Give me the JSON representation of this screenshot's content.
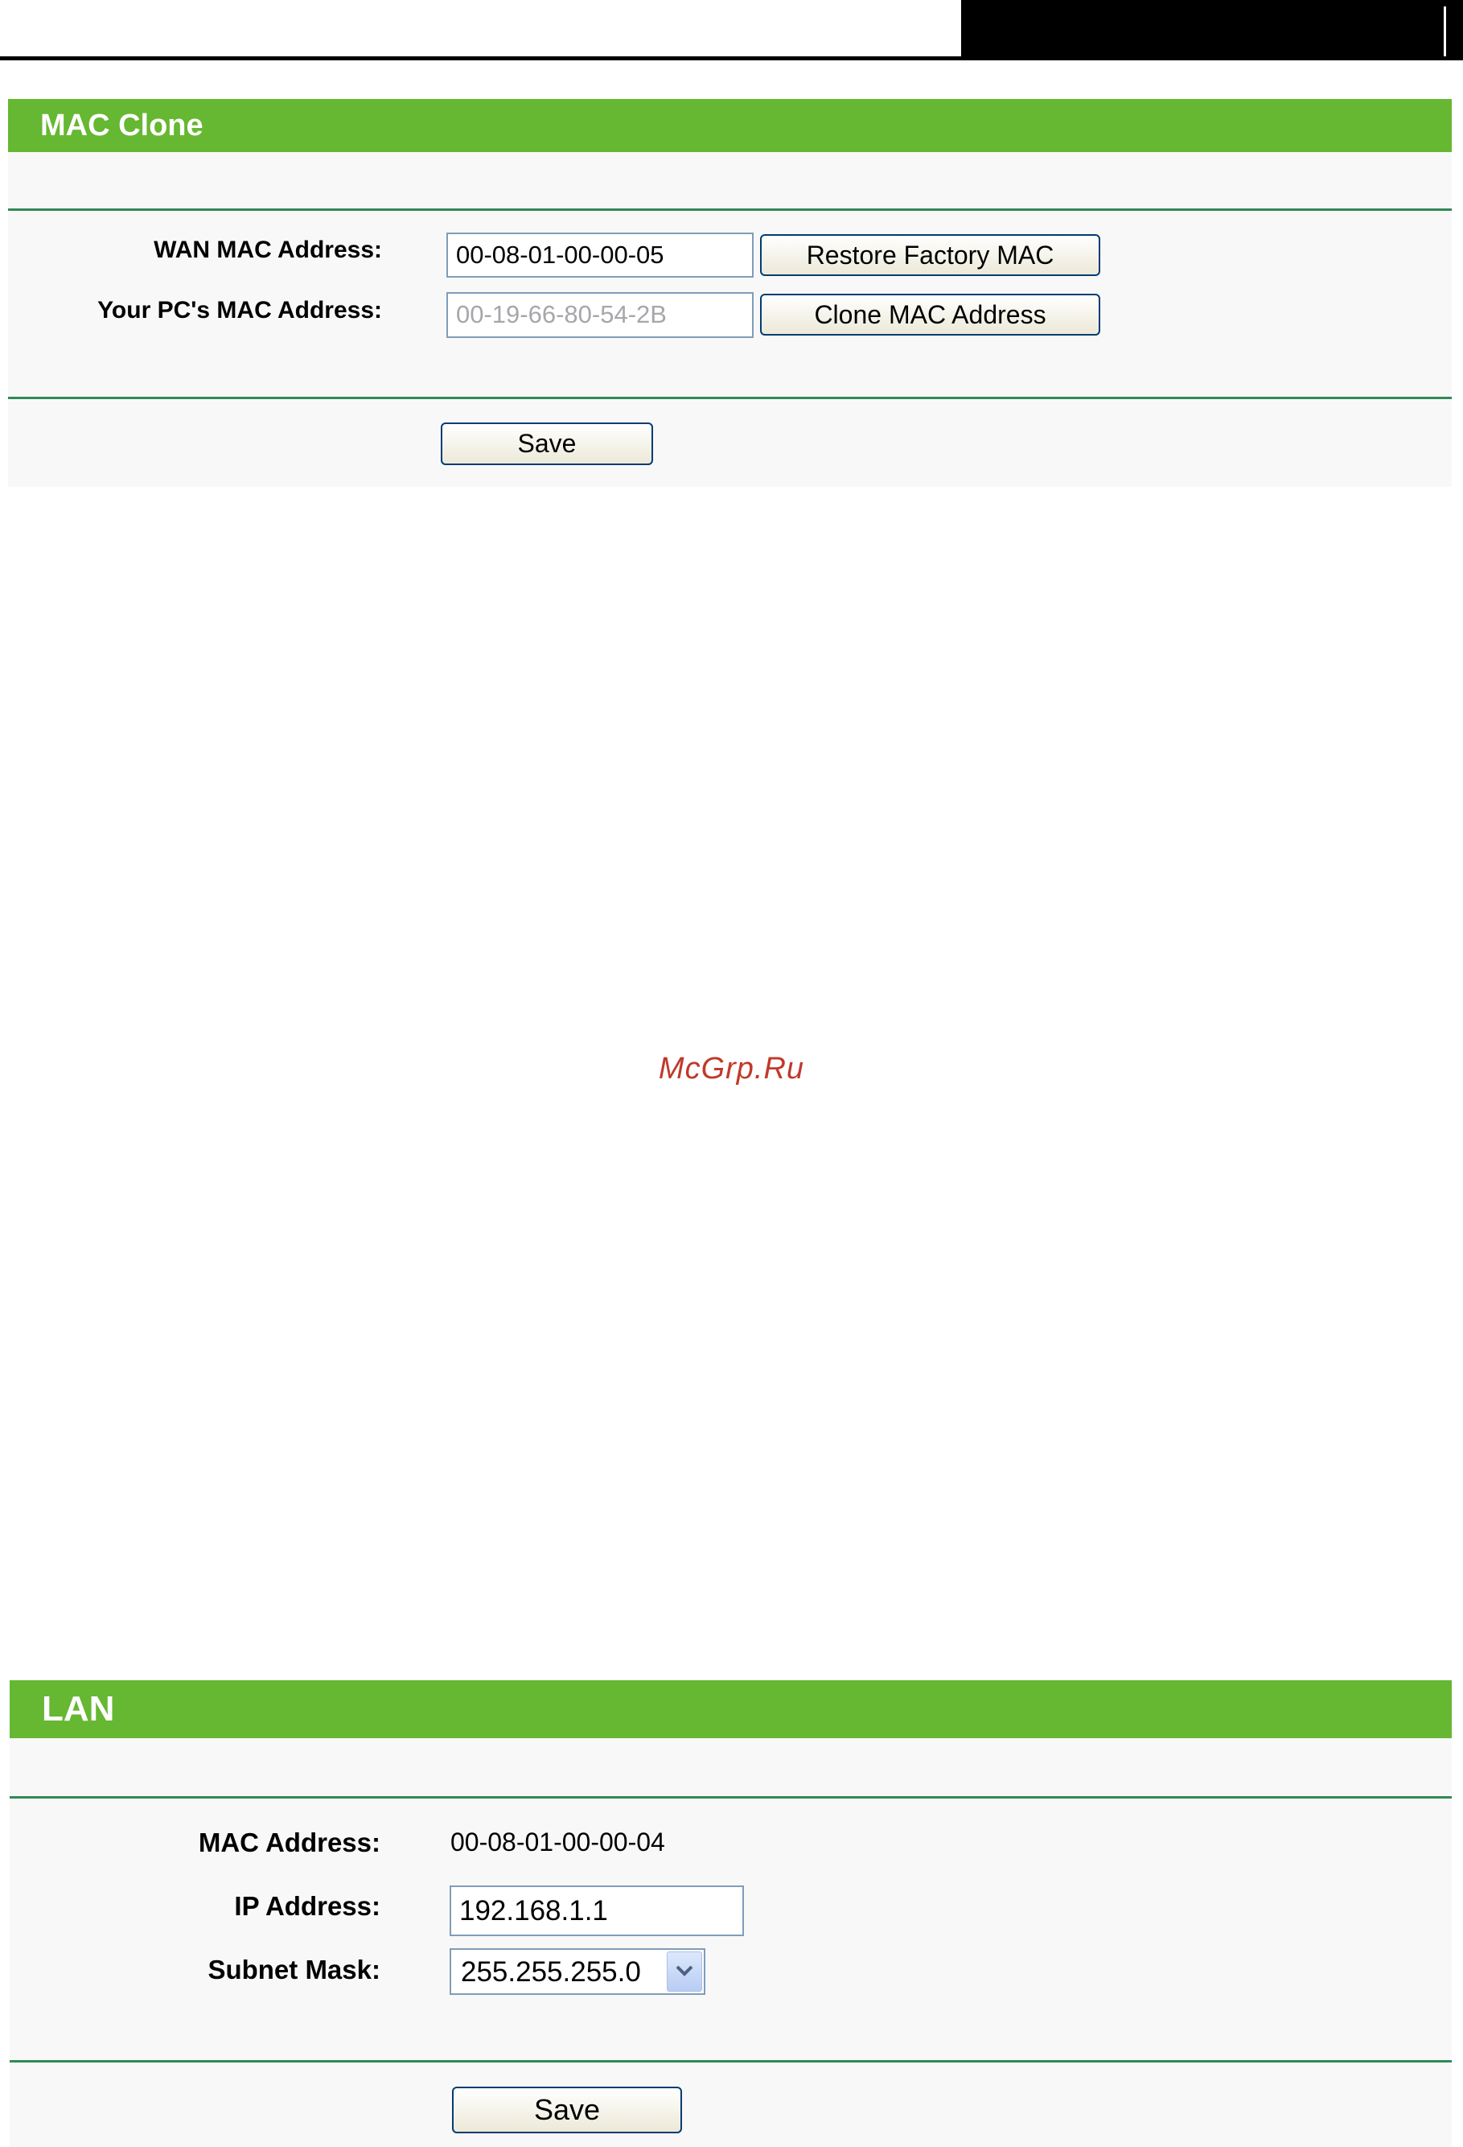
{
  "mac_clone": {
    "title": "MAC Clone",
    "wan_mac_label": "WAN MAC Address:",
    "wan_mac_value": "00-08-01-00-00-05",
    "restore_button": "Restore Factory MAC",
    "pc_mac_label": "Your PC's MAC Address:",
    "pc_mac_value": "00-19-66-80-54-2B",
    "clone_button": "Clone MAC Address",
    "save_button": "Save"
  },
  "watermark": "McGrp.Ru",
  "lan": {
    "title": "LAN",
    "mac_label": "MAC Address:",
    "mac_value": "00-08-01-00-00-04",
    "ip_label": "IP Address:",
    "ip_value": "192.168.1.1",
    "subnet_label": "Subnet Mask:",
    "subnet_value": "255.255.255.0",
    "save_button": "Save"
  },
  "colors": {
    "header_green": "#66b732",
    "divider_green": "#2f8a57",
    "watermark_red": "#c0392b"
  }
}
